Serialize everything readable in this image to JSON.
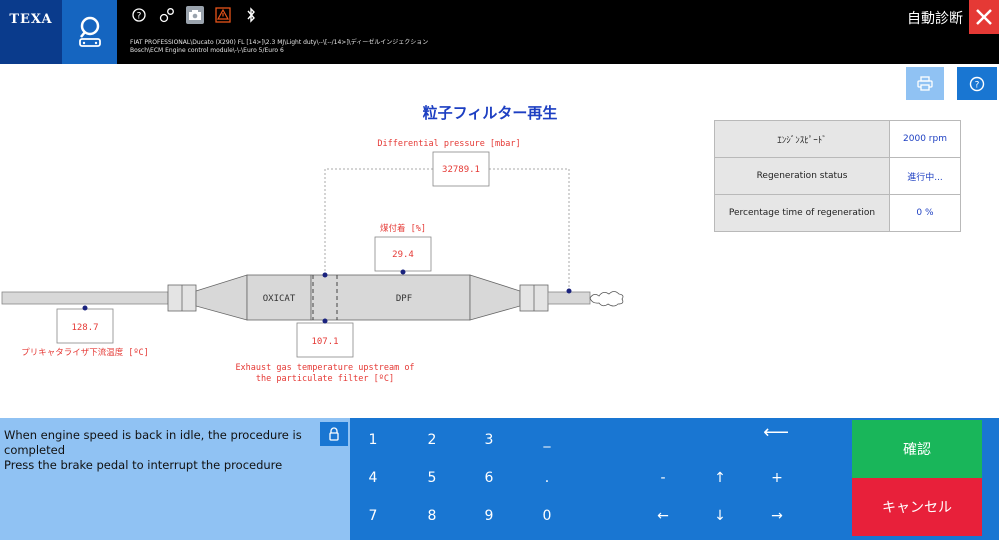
{
  "header": {
    "logo": "TEXA",
    "path_line1": "FIAT PROFESSIONAL\\Ducato (X290) FL [14>]\\2.3 MJ\\Light duty\\--\\[--/14>]\\ディーゼルインジェクション",
    "path_line2": "Bosch\\ECM Engine control module\\-\\-\\Euro 5/Euro 6",
    "mode_title": "自動診断",
    "icons": [
      "help-circle-icon",
      "settings-gears-icon",
      "camera-icon",
      "warning-icon",
      "bluetooth-icon"
    ]
  },
  "page": {
    "title": "粒子フィルター再生"
  },
  "diagram": {
    "differential_pressure": {
      "label": "Differential pressure [mbar]",
      "value": "32789.1"
    },
    "soot_load": {
      "label": "煤付着 [%]",
      "value": "29.4"
    },
    "pre_cat_temp": {
      "label": "プリキャタライザ下流温度 [ºC]",
      "value": "128.7"
    },
    "exhaust_temp": {
      "label_line1": "Exhaust gas temperature upstream of",
      "label_line2": "the particulate filter [ºC]",
      "value": "107.1"
    },
    "oxicat": "OXICAT",
    "dpf": "DPF"
  },
  "params": [
    {
      "name": "ｴﾝｼﾞﾝｽﾋﾟｰﾄﾞ",
      "value": "2000 rpm"
    },
    {
      "name": "Regeneration status",
      "value": "進行中..."
    },
    {
      "name": "Percentage time of regeneration",
      "value": "0 %"
    }
  ],
  "message": {
    "line1": "When engine speed is back in idle, the procedure is completed",
    "line2": "Press the brake pedal to interrupt the procedure"
  },
  "keypad": {
    "row1": [
      "1",
      "2",
      "3",
      "_"
    ],
    "row2": [
      "4",
      "5",
      "6",
      "."
    ],
    "row3": [
      "7",
      "8",
      "9",
      "0"
    ],
    "backspace": "⟵",
    "minus": "-",
    "up": "↑",
    "plus": "+",
    "left": "←",
    "down": "↓",
    "right": "→"
  },
  "actions": {
    "confirm": "確認",
    "cancel": "キャンセル"
  },
  "colors": {
    "accent_blue": "#1976d2",
    "light_blue": "#90c2f3",
    "value_red": "#e53935",
    "title_blue": "#1d3fc2",
    "confirm_green": "#19b65a",
    "cancel_red": "#e8203a"
  }
}
